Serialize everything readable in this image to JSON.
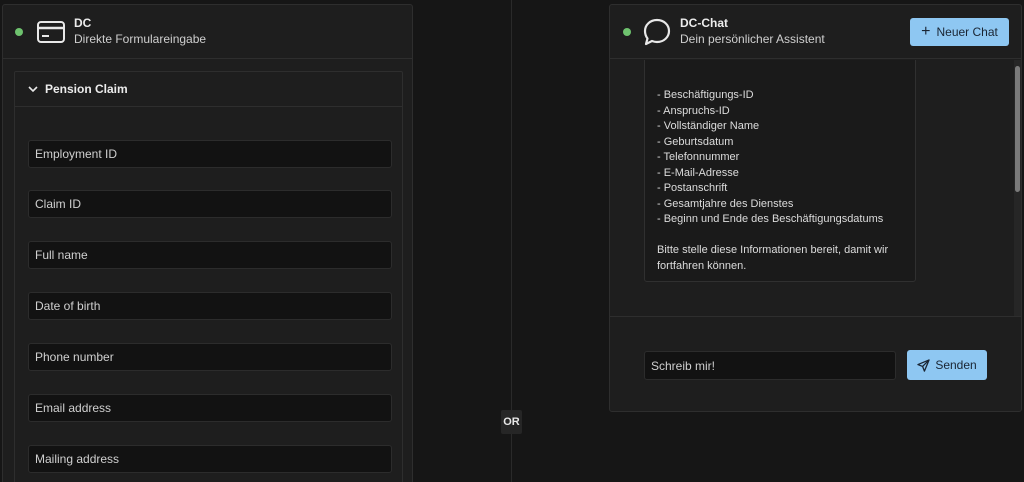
{
  "left_panel": {
    "title": "DC",
    "subtitle": "Direkte Formulareingabe",
    "status_color": "#6ec26e",
    "section": {
      "title": "Pension Claim",
      "fields": [
        {
          "placeholder": "Employment ID"
        },
        {
          "placeholder": "Claim ID"
        },
        {
          "placeholder": "Full name"
        },
        {
          "placeholder": "Date of birth"
        },
        {
          "placeholder": "Phone number"
        },
        {
          "placeholder": "Email address"
        },
        {
          "placeholder": "Mailing address"
        }
      ]
    }
  },
  "divider": {
    "label": "OR"
  },
  "right_panel": {
    "title": "DC-Chat",
    "subtitle": "Dein persönlicher Assistent",
    "new_chat_label": "Neuer Chat",
    "message": {
      "items": [
        "- Beschäftigungs-ID",
        "- Anspruchs-ID",
        "- Vollständiger Name",
        "- Geburtsdatum",
        "- Telefonnummer",
        "- E-Mail-Adresse",
        "- Postanschrift",
        "- Gesamtjahre des Dienstes",
        "- Beginn und Ende des Beschäftigungsdatums"
      ],
      "closing_line1": "Bitte stelle diese Informationen bereit, damit wir",
      "closing_line2": "fortfahren können."
    },
    "input_placeholder": "Schreib mir!",
    "send_label": "Senden"
  },
  "colors": {
    "accent": "#8ec7f2",
    "status": "#6ec26e",
    "background": "#161616",
    "panel": "#1e1e1e"
  },
  "icons": {
    "form": "credit-card-icon",
    "chat": "speech-bubble-icon",
    "collapse": "chevron-down-icon",
    "new_chat": "plus-icon",
    "send": "paper-plane-icon"
  }
}
